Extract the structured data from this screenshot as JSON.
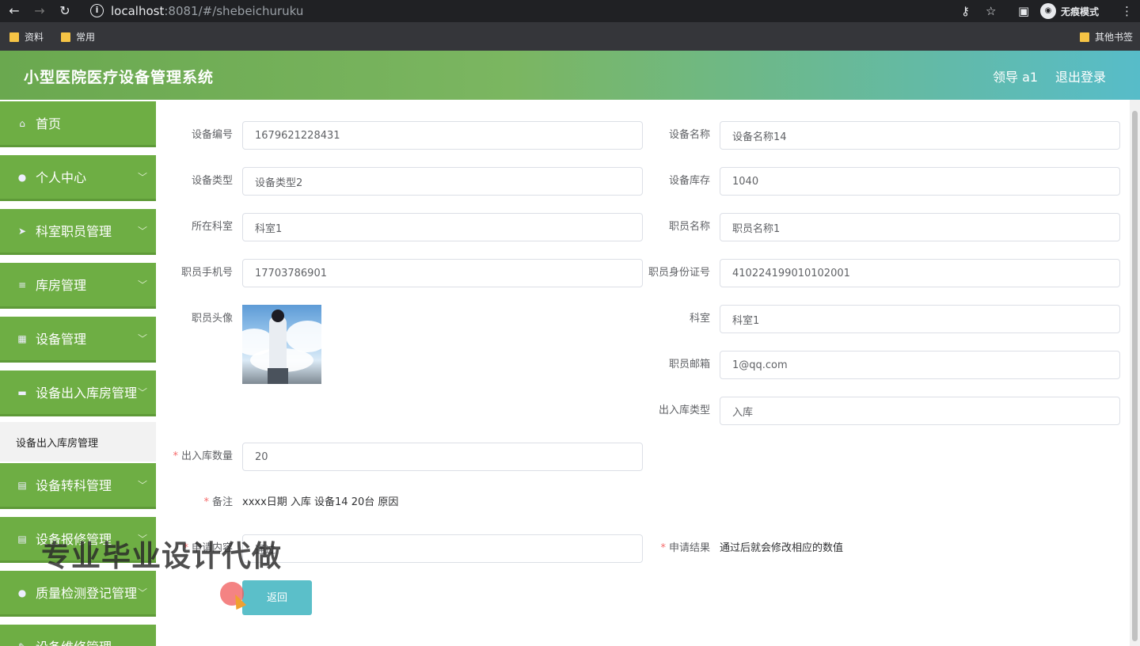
{
  "browser": {
    "url_host": "localhost",
    "url_rest": ":8081/#/shebeichuruku",
    "incognito_label": "无痕模式",
    "bookmarks": [
      "资料",
      "常用"
    ],
    "other_bookmarks": "其他书签"
  },
  "header": {
    "title": "小型医院医疗设备管理系统",
    "user": "领导 a1",
    "logout": "退出登录"
  },
  "sidebar": {
    "items": [
      {
        "label": "首页",
        "icon": "home-icon"
      },
      {
        "label": "个人中心",
        "icon": "user-icon"
      },
      {
        "label": "科室职员管理",
        "icon": "send-icon"
      },
      {
        "label": "库房管理",
        "icon": "menu-icon"
      },
      {
        "label": "设备管理",
        "icon": "grid-icon"
      },
      {
        "label": "设备出入库房管理",
        "icon": "box-icon"
      },
      {
        "label": "设备转科管理",
        "icon": "clipboard-icon"
      },
      {
        "label": "设备报修管理",
        "icon": "clipboard-icon"
      },
      {
        "label": "质量检测登记管理",
        "icon": "user-icon"
      },
      {
        "label": "设备维修管理",
        "icon": "tool-icon"
      }
    ],
    "active_sub": "设备出入库房管理"
  },
  "form": {
    "device_no": {
      "label": "设备编号",
      "value": "1679621228431"
    },
    "device_name": {
      "label": "设备名称",
      "value": "设备名称14"
    },
    "device_type": {
      "label": "设备类型",
      "value": "设备类型2"
    },
    "device_stock": {
      "label": "设备库存",
      "value": "1040"
    },
    "department": {
      "label": "所在科室",
      "value": "科室1"
    },
    "staff_name": {
      "label": "职员名称",
      "value": "职员名称1"
    },
    "staff_phone": {
      "label": "职员手机号",
      "value": "17703786901"
    },
    "staff_id": {
      "label": "职员身份证号",
      "value": "410224199010102001"
    },
    "staff_avatar": {
      "label": "职员头像"
    },
    "office": {
      "label": "科室",
      "value": "科室1"
    },
    "staff_email": {
      "label": "职员邮箱",
      "value": "1@qq.com"
    },
    "io_type": {
      "label": "出入库类型",
      "value": "入库"
    },
    "io_qty": {
      "label": "出入库数量",
      "value": "20"
    },
    "remark": {
      "label": "备注",
      "value": "xxxx日期 入库 设备14 20台 原因"
    },
    "apply_content": {
      "label": "申请内容",
      "value": "通过"
    },
    "apply_result": {
      "label": "申请结果",
      "value": "通过后就会修改相应的数值"
    },
    "back_button": "返回"
  },
  "overlay": {
    "watermark": "专业毕业设计代做"
  }
}
